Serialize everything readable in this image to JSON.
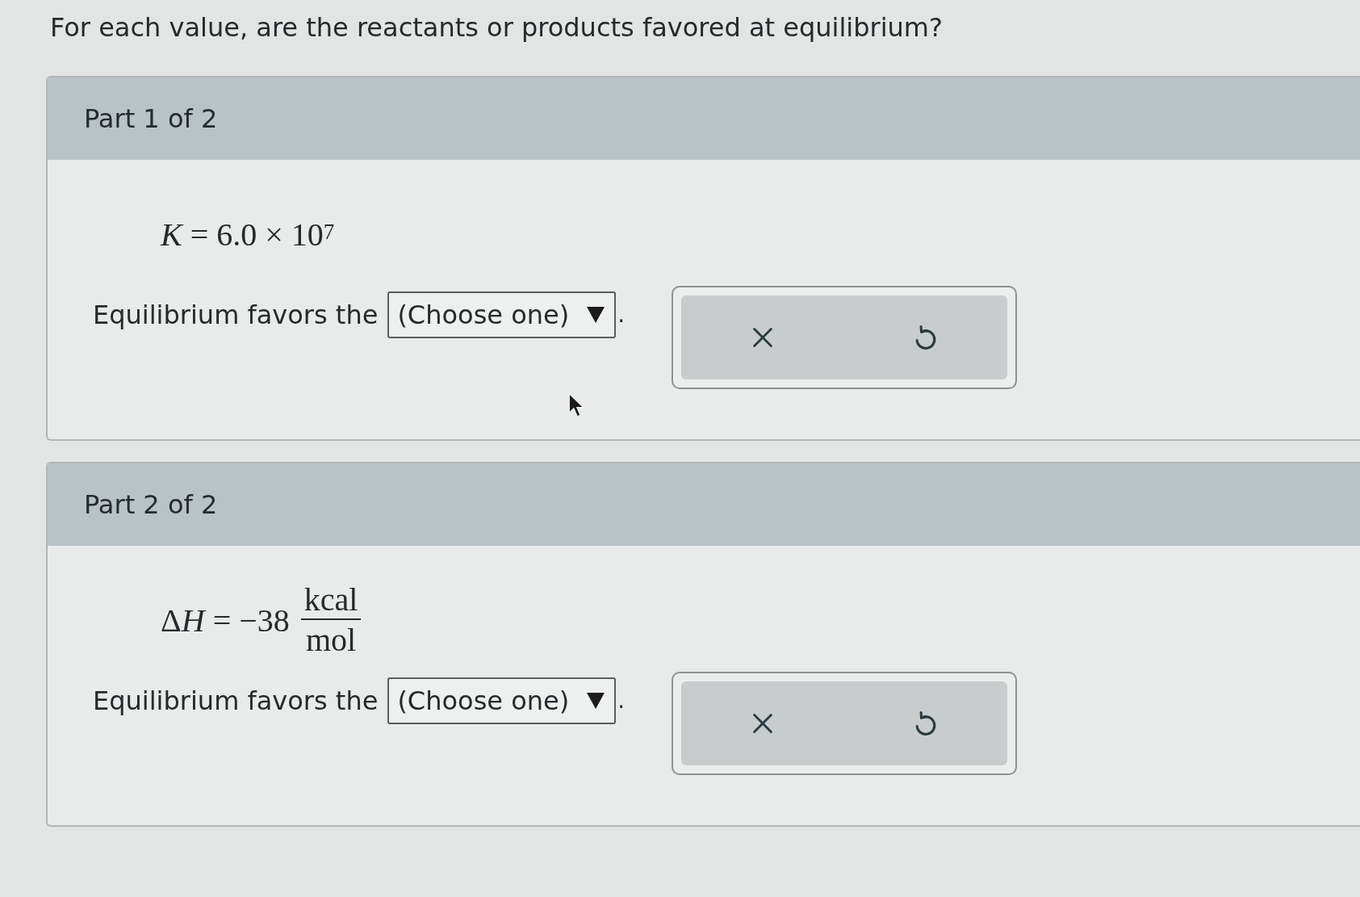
{
  "question": "For each value, are the reactants or products favored at equilibrium?",
  "parts": [
    {
      "title": "Part 1 of 2",
      "equation": {
        "kind": "inline",
        "text": "*K* = 6.0 × 10$^{7}$"
      },
      "prompt": "Equilibrium favors the",
      "dropdown": {
        "placeholder": "(Choose one)"
      },
      "suffix": "."
    },
    {
      "title": "Part 2 of 2",
      "equation": {
        "kind": "fraction",
        "prefix": "Δ",
        "variable": "H",
        "value": "= −38",
        "numerator": "kcal",
        "denominator": "mol"
      },
      "prompt": "Equilibrium favors the",
      "dropdown": {
        "placeholder": "(Choose one)"
      },
      "suffix": "."
    }
  ]
}
